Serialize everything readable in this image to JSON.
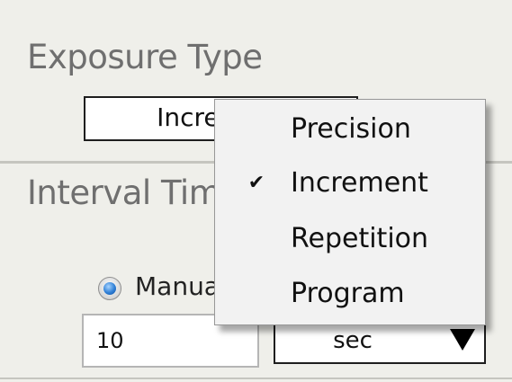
{
  "exposure_type": {
    "title": "Exposure Type",
    "selected_value": "Increment"
  },
  "interval_time": {
    "title": "Interval Time",
    "radio_label": "Manual",
    "radio_selected": true,
    "input_value": "10",
    "unit": "sec"
  },
  "dropdown_menu": {
    "items": [
      {
        "label": "Precision",
        "checked": false
      },
      {
        "label": "Increment",
        "checked": true
      },
      {
        "label": "Repetition",
        "checked": false
      },
      {
        "label": "Program",
        "checked": false
      }
    ],
    "check_glyph": "✔"
  }
}
